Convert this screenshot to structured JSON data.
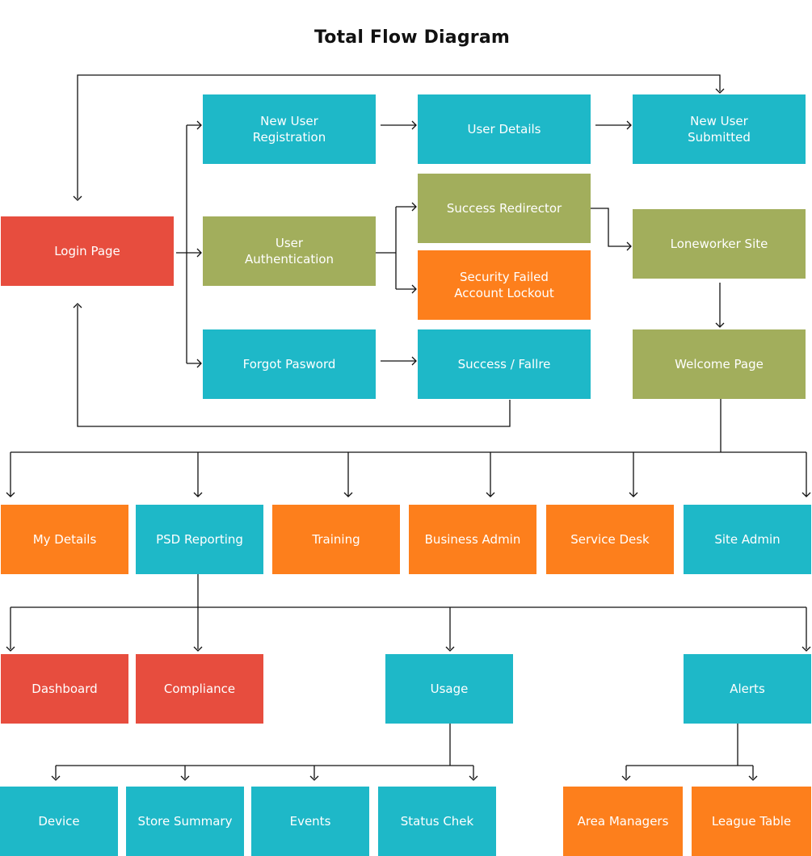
{
  "title": "Total Flow Diagram",
  "colors": {
    "teal": "#1EB8C8",
    "olive": "#A2AE5C",
    "orange": "#FD7F1C",
    "red": "#E74D3E",
    "line": "#111111"
  },
  "nodes": [
    {
      "id": "login-page",
      "label": "Login Page",
      "color": "red"
    },
    {
      "id": "new-user-registration",
      "label": "New User\nRegistration",
      "color": "teal"
    },
    {
      "id": "user-authentication",
      "label": "User\nAuthentication",
      "color": "olive"
    },
    {
      "id": "forgot-pasword",
      "label": "Forgot Pasword",
      "color": "teal"
    },
    {
      "id": "user-details",
      "label": "User Details",
      "color": "teal"
    },
    {
      "id": "success-redirector",
      "label": "Success Redirector",
      "color": "olive"
    },
    {
      "id": "security-failed-account-lockout",
      "label": "Security Failed\nAccount Lockout",
      "color": "orange"
    },
    {
      "id": "success-fallre",
      "label": "Success / Fallre",
      "color": "teal"
    },
    {
      "id": "new-user-submitted",
      "label": "New User\nSubmitted",
      "color": "teal"
    },
    {
      "id": "loneworker-site",
      "label": "Loneworker Site",
      "color": "olive"
    },
    {
      "id": "welcome-page",
      "label": "Welcome Page",
      "color": "olive"
    },
    {
      "id": "my-details",
      "label": "My Details",
      "color": "orange"
    },
    {
      "id": "psd-reporting",
      "label": "PSD Reporting",
      "color": "teal"
    },
    {
      "id": "training",
      "label": "Training",
      "color": "orange"
    },
    {
      "id": "business-admin",
      "label": "Business Admin",
      "color": "orange"
    },
    {
      "id": "service-desk",
      "label": "Service Desk",
      "color": "orange"
    },
    {
      "id": "site-admin",
      "label": "Site Admin",
      "color": "teal"
    },
    {
      "id": "dashboard",
      "label": "Dashboard",
      "color": "red"
    },
    {
      "id": "compliance",
      "label": "Compliance",
      "color": "red"
    },
    {
      "id": "usage",
      "label": "Usage",
      "color": "teal"
    },
    {
      "id": "alerts",
      "label": "Alerts",
      "color": "teal"
    },
    {
      "id": "device",
      "label": "Device",
      "color": "teal"
    },
    {
      "id": "store-summary",
      "label": "Store Summary",
      "color": "teal"
    },
    {
      "id": "events",
      "label": "Events",
      "color": "teal"
    },
    {
      "id": "status-chek",
      "label": "Status Chek",
      "color": "teal"
    },
    {
      "id": "area-managers",
      "label": "Area Managers",
      "color": "orange"
    },
    {
      "id": "league-table",
      "label": "League Table",
      "color": "orange"
    }
  ],
  "edges": [
    {
      "from": "login-page",
      "to": "new-user-registration"
    },
    {
      "from": "login-page",
      "to": "user-authentication"
    },
    {
      "from": "login-page",
      "to": "forgot-pasword"
    },
    {
      "from": "new-user-registration",
      "to": "user-details"
    },
    {
      "from": "user-details",
      "to": "new-user-submitted"
    },
    {
      "from": "login-page",
      "to": "new-user-submitted",
      "bidirectional": true
    },
    {
      "from": "user-authentication",
      "to": "success-redirector"
    },
    {
      "from": "user-authentication",
      "to": "security-failed-account-lockout"
    },
    {
      "from": "success-redirector",
      "to": "loneworker-site"
    },
    {
      "from": "loneworker-site",
      "to": "welcome-page"
    },
    {
      "from": "forgot-pasword",
      "to": "success-fallre"
    },
    {
      "from": "success-fallre",
      "to": "login-page"
    },
    {
      "from": "welcome-page",
      "to": "my-details"
    },
    {
      "from": "welcome-page",
      "to": "psd-reporting"
    },
    {
      "from": "welcome-page",
      "to": "training"
    },
    {
      "from": "welcome-page",
      "to": "business-admin"
    },
    {
      "from": "welcome-page",
      "to": "service-desk"
    },
    {
      "from": "welcome-page",
      "to": "site-admin"
    },
    {
      "from": "psd-reporting",
      "to": "dashboard"
    },
    {
      "from": "psd-reporting",
      "to": "compliance"
    },
    {
      "from": "psd-reporting",
      "to": "usage"
    },
    {
      "from": "psd-reporting",
      "to": "alerts"
    },
    {
      "from": "usage",
      "to": "device"
    },
    {
      "from": "usage",
      "to": "store-summary"
    },
    {
      "from": "usage",
      "to": "events"
    },
    {
      "from": "usage",
      "to": "status-chek"
    },
    {
      "from": "alerts",
      "to": "area-managers"
    },
    {
      "from": "alerts",
      "to": "league-table"
    }
  ]
}
